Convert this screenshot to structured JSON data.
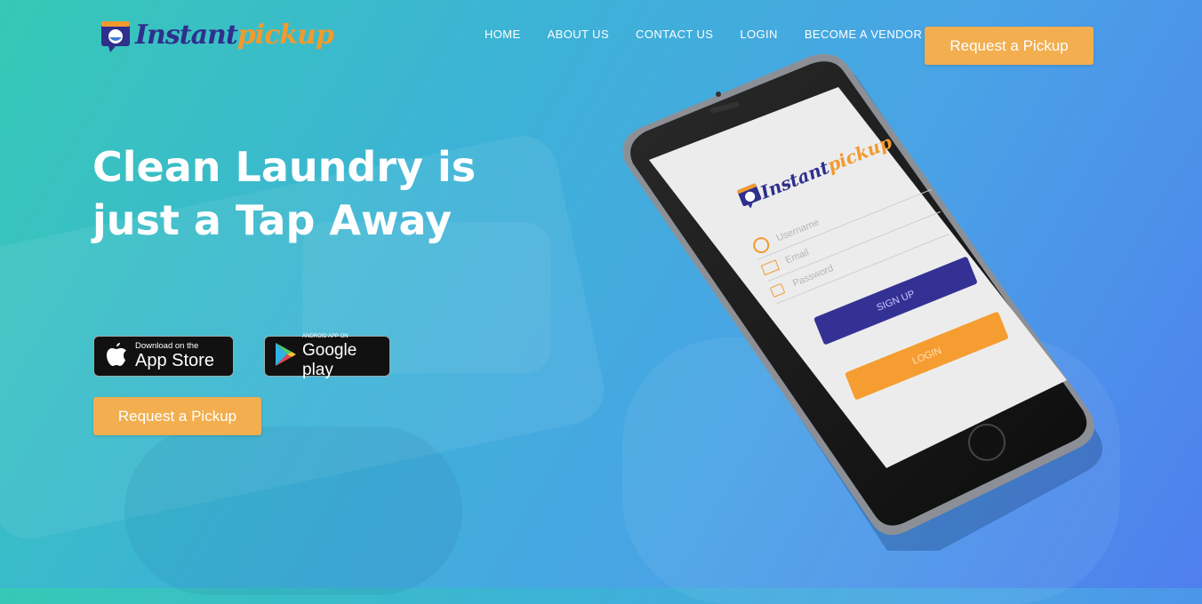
{
  "brand": {
    "part1": "Instant",
    "part2": "pickup",
    "accent": "#f2ae4f",
    "primary": "#2f2f8c"
  },
  "nav": {
    "items": [
      "HOME",
      "ABOUT US",
      "CONTACT US",
      "LOGIN",
      "BECOME A VENDOR"
    ],
    "cta": "Request a Pickup"
  },
  "hero": {
    "title_line1": "Clean Laundry is",
    "title_line2": "just a Tap Away",
    "cta": "Request a Pickup"
  },
  "stores": {
    "apple": {
      "small": "Download on the",
      "big": "App Store",
      "icon": "apple-icon"
    },
    "google": {
      "small": "ANDROID APP ON",
      "big": "Google play",
      "icon": "google-play-icon"
    }
  },
  "phone_screen": {
    "brand_part1": "Instant",
    "brand_part2": "pickup",
    "username_placeholder": "Username",
    "email_placeholder": "Email",
    "password_placeholder": "Password",
    "signup_label": "SIGN UP",
    "login_label": "LOGIN"
  }
}
